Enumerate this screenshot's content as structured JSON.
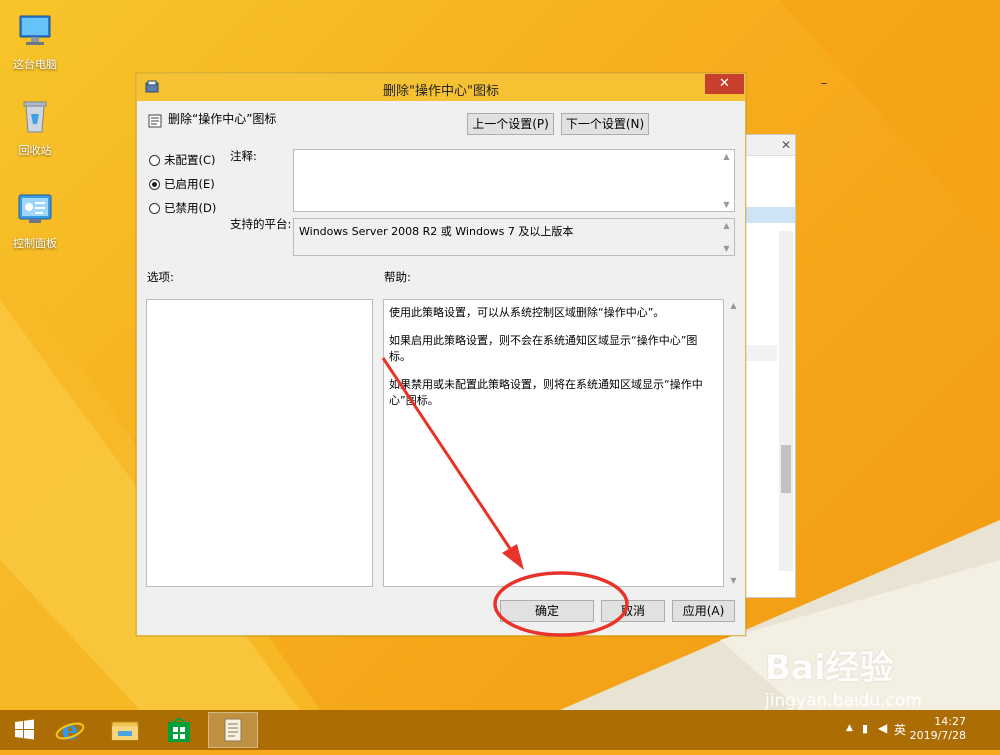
{
  "desktop": {
    "icons": [
      {
        "label": "这台电脑"
      },
      {
        "label": "回收站"
      },
      {
        "label": "控制面板"
      }
    ]
  },
  "dialog": {
    "title": "删除\"操作中心\"图标",
    "policy_name": "删除“操作中心”图标",
    "prev_button": "上一个设置(P)",
    "next_button": "下一个设置(N)",
    "radios": [
      {
        "label": "未配置(C)",
        "selected": false
      },
      {
        "label": "已启用(E)",
        "selected": true
      },
      {
        "label": "已禁用(D)",
        "selected": false
      }
    ],
    "comment_label": "注释:",
    "platform_label": "支持的平台:",
    "platform_value": "Windows Server 2008 R2 或 Windows 7 及以上版本",
    "options_label": "选项:",
    "help_label": "帮助:",
    "help_text": [
      "使用此策略设置，可以从系统控制区域删除“操作中心”。",
      "如果启用此策略设置，则不会在系统通知区域显示“操作中心”图标。",
      "如果禁用或未配置此策略设置，则将在系统通知区域显示“操作中心”图标。"
    ],
    "ok_button": "确定",
    "cancel_button": "取消",
    "apply_button": "应用(A)"
  },
  "taskbar": {
    "tray_lang": "英",
    "time": "14:27",
    "date": "2019/7/28"
  },
  "watermark": {
    "logo": "Bai经验",
    "url": "jingyan.baidu.com"
  },
  "colors": {
    "titlebar": "#f6c233",
    "close": "#c7402d",
    "taskbar": "#ad6d05",
    "annotation": "#e8332b"
  }
}
